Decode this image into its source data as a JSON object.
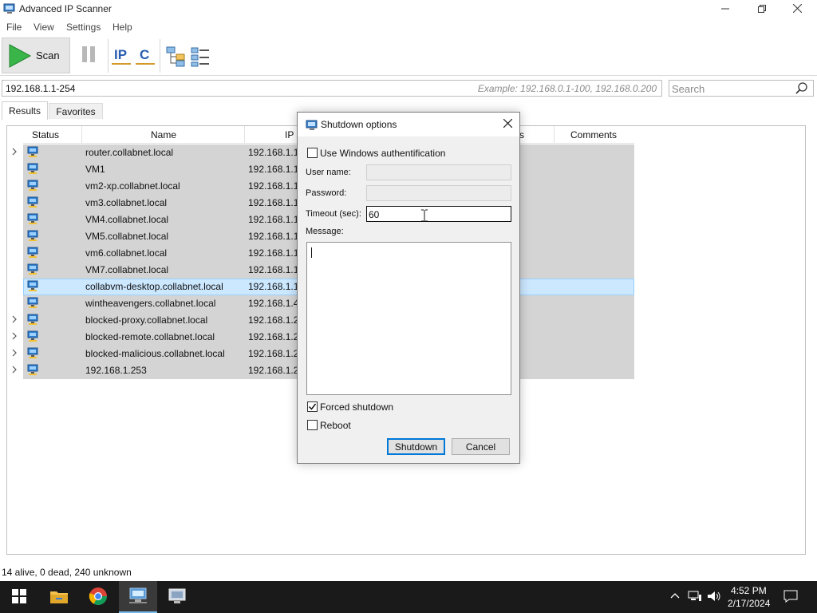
{
  "window": {
    "title": "Advanced IP Scanner"
  },
  "menu": {
    "items": [
      "File",
      "View",
      "Settings",
      "Help"
    ]
  },
  "toolbar": {
    "scan_label": "Scan",
    "icons": [
      "play-icon",
      "pause-icon",
      "ip-scan-icon",
      "c-subnet-icon",
      "network-tree-icon",
      "list-view-icon"
    ]
  },
  "range": {
    "value": "192.168.1.1-254",
    "example": "Example: 192.168.0.1-100, 192.168.0.200"
  },
  "search": {
    "placeholder": "Search"
  },
  "tabs": [
    {
      "label": "Results"
    },
    {
      "label": "Favorites"
    }
  ],
  "grid": {
    "columns": {
      "status": "Status",
      "name": "Name",
      "ip": "IP",
      "mac_partial": "ss",
      "comments": "Comments"
    },
    "rows": [
      {
        "name": "router.collabnet.local",
        "ip": "192.168.1.1",
        "expandable": true,
        "selected": false
      },
      {
        "name": "VM1",
        "ip": "192.168.1.11",
        "expandable": false,
        "selected": false
      },
      {
        "name": "vm2-xp.collabnet.local",
        "ip": "192.168.1.12",
        "expandable": false,
        "selected": false
      },
      {
        "name": "vm3.collabnet.local",
        "ip": "192.168.1.13",
        "expandable": false,
        "selected": false
      },
      {
        "name": "VM4.collabnet.local",
        "ip": "192.168.1.14",
        "expandable": false,
        "selected": false
      },
      {
        "name": "VM5.collabnet.local",
        "ip": "192.168.1.15",
        "expandable": false,
        "selected": false
      },
      {
        "name": "vm6.collabnet.local",
        "ip": "192.168.1.16",
        "expandable": false,
        "selected": false
      },
      {
        "name": "VM7.collabnet.local",
        "ip": "192.168.1.17",
        "expandable": false,
        "selected": false
      },
      {
        "name": "collabvm-desktop.collabnet.local",
        "ip": "192.168.1.18",
        "expandable": false,
        "selected": true
      },
      {
        "name": "wintheavengers.collabnet.local",
        "ip": "192.168.1.41",
        "expandable": false,
        "selected": false
      },
      {
        "name": "blocked-proxy.collabnet.local",
        "ip": "192.168.1.25",
        "expandable": true,
        "selected": false
      },
      {
        "name": "blocked-remote.collabnet.local",
        "ip": "192.168.1.25",
        "expandable": true,
        "selected": false
      },
      {
        "name": "blocked-malicious.collabnet.local",
        "ip": "192.168.1.25",
        "expandable": true,
        "selected": false
      },
      {
        "name": "192.168.1.253",
        "ip": "192.168.1.25",
        "expandable": true,
        "selected": false
      }
    ]
  },
  "status": {
    "text": "14 alive, 0 dead, 240 unknown"
  },
  "dialog": {
    "title": "Shutdown options",
    "use_windows_auth_label": "Use Windows authentification",
    "use_windows_auth_checked": false,
    "username_label": "User name:",
    "username_value": "",
    "password_label": "Password:",
    "password_value": "",
    "timeout_label": "Timeout (sec):",
    "timeout_value": "60",
    "message_label": "Message:",
    "message_value": "",
    "forced_label": "Forced shutdown",
    "forced_checked": true,
    "reboot_label": "Reboot",
    "reboot_checked": false,
    "shutdown_button": "Shutdown",
    "cancel_button": "Cancel"
  },
  "taskbar": {
    "apps": [
      "windows-start-icon",
      "file-explorer-icon",
      "chrome-icon",
      "advanced-ip-scanner-icon",
      "remote-app-icon"
    ],
    "tray": [
      "chevron-up-icon",
      "network-icon",
      "volume-icon"
    ],
    "time": "4:52 PM",
    "date": "2/17/2024"
  },
  "colors": {
    "selection": "#cce8ff",
    "row_fill": "#d4d4d4",
    "accent": "#0078d7",
    "taskbar": "#1a1a1a"
  }
}
